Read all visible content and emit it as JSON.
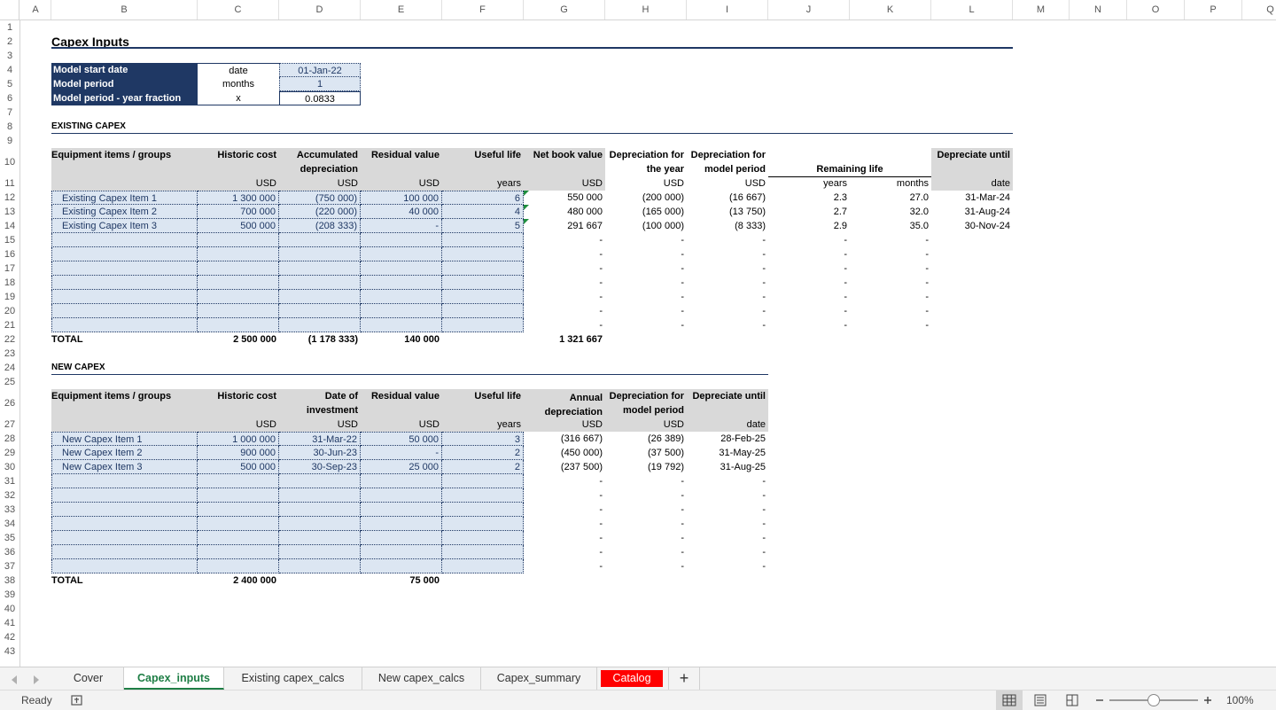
{
  "columns": [
    "A",
    "B",
    "C",
    "D",
    "E",
    "F",
    "G",
    "H",
    "I",
    "J",
    "K",
    "L",
    "M",
    "N",
    "O",
    "P",
    "Q"
  ],
  "rows": [
    "1",
    "2",
    "3",
    "4",
    "5",
    "6",
    "7",
    "8",
    "9",
    "10",
    "11",
    "12",
    "13",
    "14",
    "15",
    "16",
    "17",
    "18",
    "19",
    "20",
    "21",
    "22",
    "23",
    "24",
    "25",
    "26",
    "27",
    "28",
    "29",
    "30",
    "31",
    "32",
    "33",
    "34",
    "35",
    "36",
    "37",
    "38",
    "39",
    "40",
    "41",
    "42",
    "43"
  ],
  "sheet_title": "Capex Inputs",
  "model": [
    {
      "label": "Model start date",
      "unit": "date",
      "value": "01-Jan-22"
    },
    {
      "label": "Model period",
      "unit": "months",
      "value": "1"
    },
    {
      "label": "Model period - year fraction",
      "unit": "x",
      "value": "0.0833"
    }
  ],
  "existing": {
    "section": "EXISTING CAPEX",
    "headers": {
      "item": "Equipment items / groups",
      "cost": "Historic cost",
      "acc1": "Accumulated",
      "acc2": "depreciation",
      "resid": "Residual value",
      "life": "Useful life",
      "nbv": "Net book value",
      "dep_year1": "Depreciation for",
      "dep_year2": "the year",
      "dep_period1": "Depreciation for",
      "dep_period2": "model period",
      "remaining": "Remaining life",
      "dep_until": "Depreciate until"
    },
    "units": {
      "cost": "USD",
      "acc": "USD",
      "resid": "USD",
      "life": "years",
      "nbv": "USD",
      "dep_year": "USD",
      "dep_period": "USD",
      "rem_years": "years",
      "rem_months": "months",
      "until": "date"
    },
    "items": [
      {
        "name": "Existing Capex Item 1",
        "cost": "1 300 000",
        "acc": "(750 000)",
        "resid": "100 000",
        "life": "6",
        "nbv": "550 000",
        "dep_year": "(200 000)",
        "dep_period": "(16 667)",
        "rem_years": "2.3",
        "rem_months": "27.0",
        "until": "31-Mar-24"
      },
      {
        "name": "Existing Capex Item 2",
        "cost": "700 000",
        "acc": "(220 000)",
        "resid": "40 000",
        "life": "4",
        "nbv": "480 000",
        "dep_year": "(165 000)",
        "dep_period": "(13 750)",
        "rem_years": "2.7",
        "rem_months": "32.0",
        "until": "31-Aug-24"
      },
      {
        "name": "Existing Capex Item 3",
        "cost": "500 000",
        "acc": "(208 333)",
        "resid": "-",
        "life": "5",
        "nbv": "291 667",
        "dep_year": "(100 000)",
        "dep_period": "(8 333)",
        "rem_years": "2.9",
        "rem_months": "35.0",
        "until": "30-Nov-24"
      }
    ],
    "empty_dash": "-",
    "total": {
      "label": "TOTAL",
      "cost": "2 500 000",
      "acc": "(1 178 333)",
      "resid": "140 000",
      "nbv": "1 321 667"
    }
  },
  "new": {
    "section": "NEW CAPEX",
    "headers": {
      "item": "Equipment items / groups",
      "cost": "Historic cost",
      "date1": "Date of",
      "date2": "investment",
      "resid": "Residual value",
      "life": "Useful life",
      "annual1": "Annual",
      "annual2": "depreciation",
      "dep_period1": "Depreciation for",
      "dep_period2": "model period",
      "dep_until": "Depreciate until"
    },
    "units": {
      "cost": "USD",
      "date": "USD",
      "resid": "USD",
      "life": "years",
      "annual": "USD",
      "dep_period": "USD",
      "until": "date"
    },
    "items": [
      {
        "name": "New Capex Item 1",
        "cost": "1 000 000",
        "date": "31-Mar-22",
        "resid": "50 000",
        "life": "3",
        "annual": "(316 667)",
        "dep_period": "(26 389)",
        "until": "28-Feb-25"
      },
      {
        "name": "New Capex Item 2",
        "cost": "900 000",
        "date": "30-Jun-23",
        "resid": "-",
        "life": "2",
        "annual": "(450 000)",
        "dep_period": "(37 500)",
        "until": "31-May-25"
      },
      {
        "name": "New Capex Item 3",
        "cost": "500 000",
        "date": "30-Sep-23",
        "resid": "25 000",
        "life": "2",
        "annual": "(237 500)",
        "dep_period": "(19 792)",
        "until": "31-Aug-25"
      }
    ],
    "empty_dash": "-",
    "total": {
      "label": "TOTAL",
      "cost": "2 400 000",
      "resid": "75 000"
    }
  },
  "tabs": [
    {
      "label": "Cover",
      "state": "normal"
    },
    {
      "label": "Capex_inputs",
      "state": "active"
    },
    {
      "label": "Existing capex_calcs",
      "state": "normal"
    },
    {
      "label": "New capex_calcs",
      "state": "normal"
    },
    {
      "label": "Capex_summary",
      "state": "normal"
    },
    {
      "label": "Catalog",
      "state": "red"
    }
  ],
  "add_sheet": "+",
  "status": {
    "ready": "Ready",
    "zoom": "100%",
    "zoom_level": 0.5
  },
  "colors": {
    "accent_navy": "#1f3864",
    "input_fill": "#dce6f2",
    "active_tab": "#1e7e45",
    "red_tab": "#ff0000"
  },
  "icons": {
    "prev": "prev-sheet-icon",
    "next": "next-sheet-icon",
    "access": "accessibility-icon",
    "normal": "normal-view-icon",
    "layout": "page-layout-icon",
    "break": "page-break-icon",
    "zoom_out": "zoom-out-icon",
    "zoom_in": "zoom-in-icon"
  }
}
